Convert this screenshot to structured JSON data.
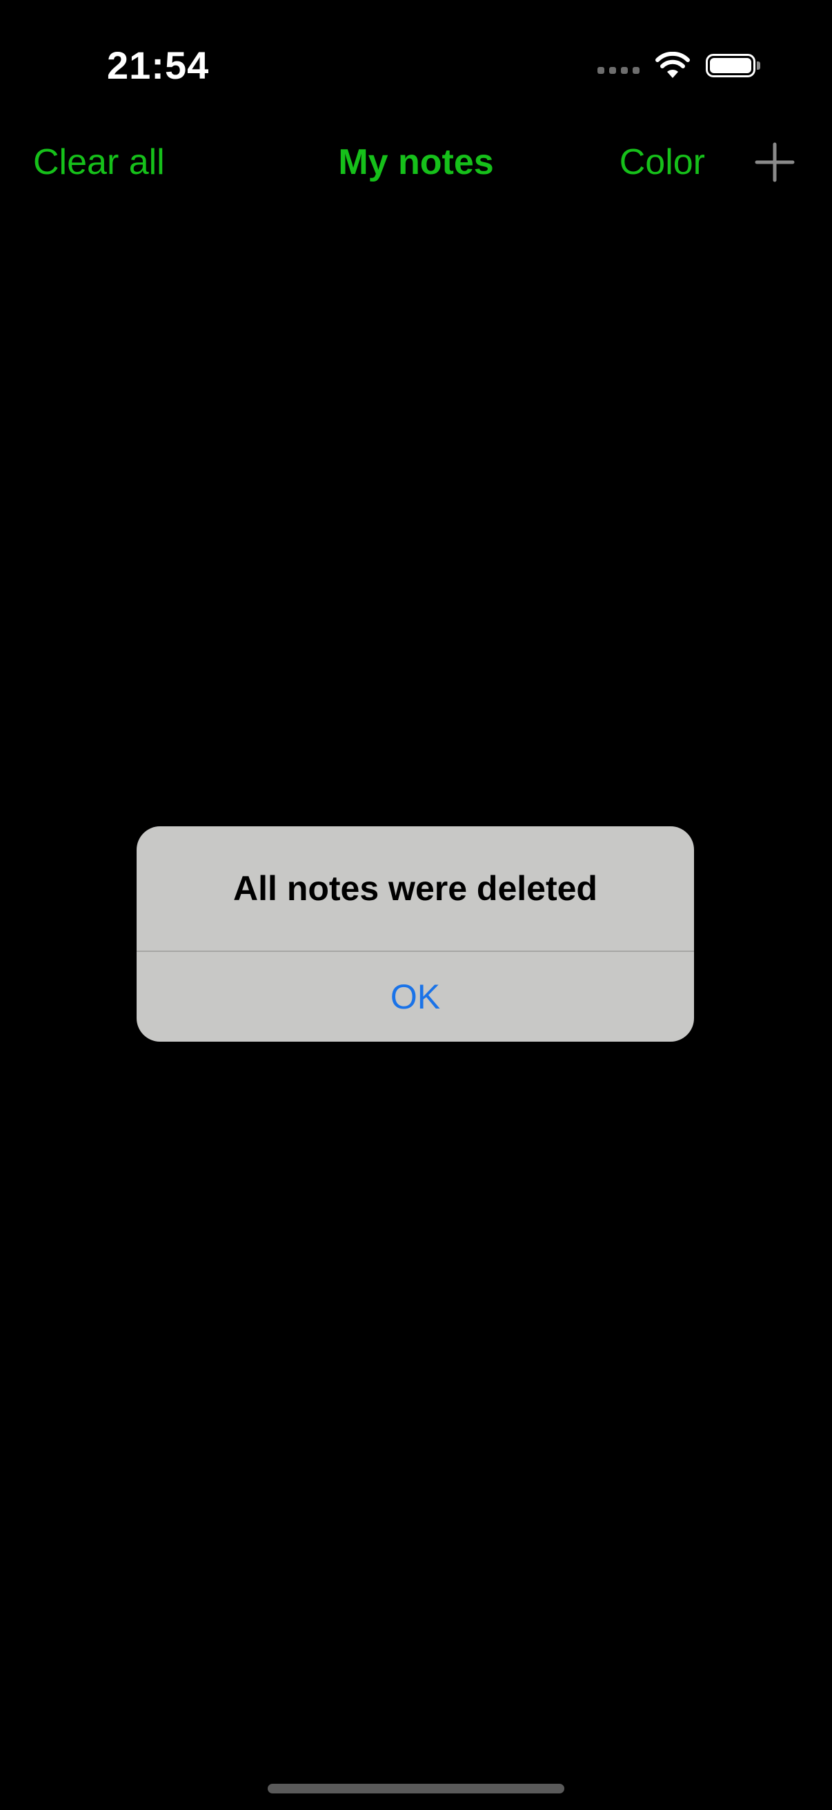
{
  "status_bar": {
    "time": "21:54",
    "icons": [
      "signal-dots-icon",
      "wifi-icon",
      "battery-icon"
    ]
  },
  "nav": {
    "clear_label": "Clear all",
    "title": "My notes",
    "color_label": "Color",
    "add_icon": "plus-icon",
    "accent_color": "#16c01a"
  },
  "alert": {
    "title": "All notes were deleted",
    "ok_label": "OK",
    "background_color": "#c8c8c6",
    "ok_color": "#1a73e8"
  }
}
